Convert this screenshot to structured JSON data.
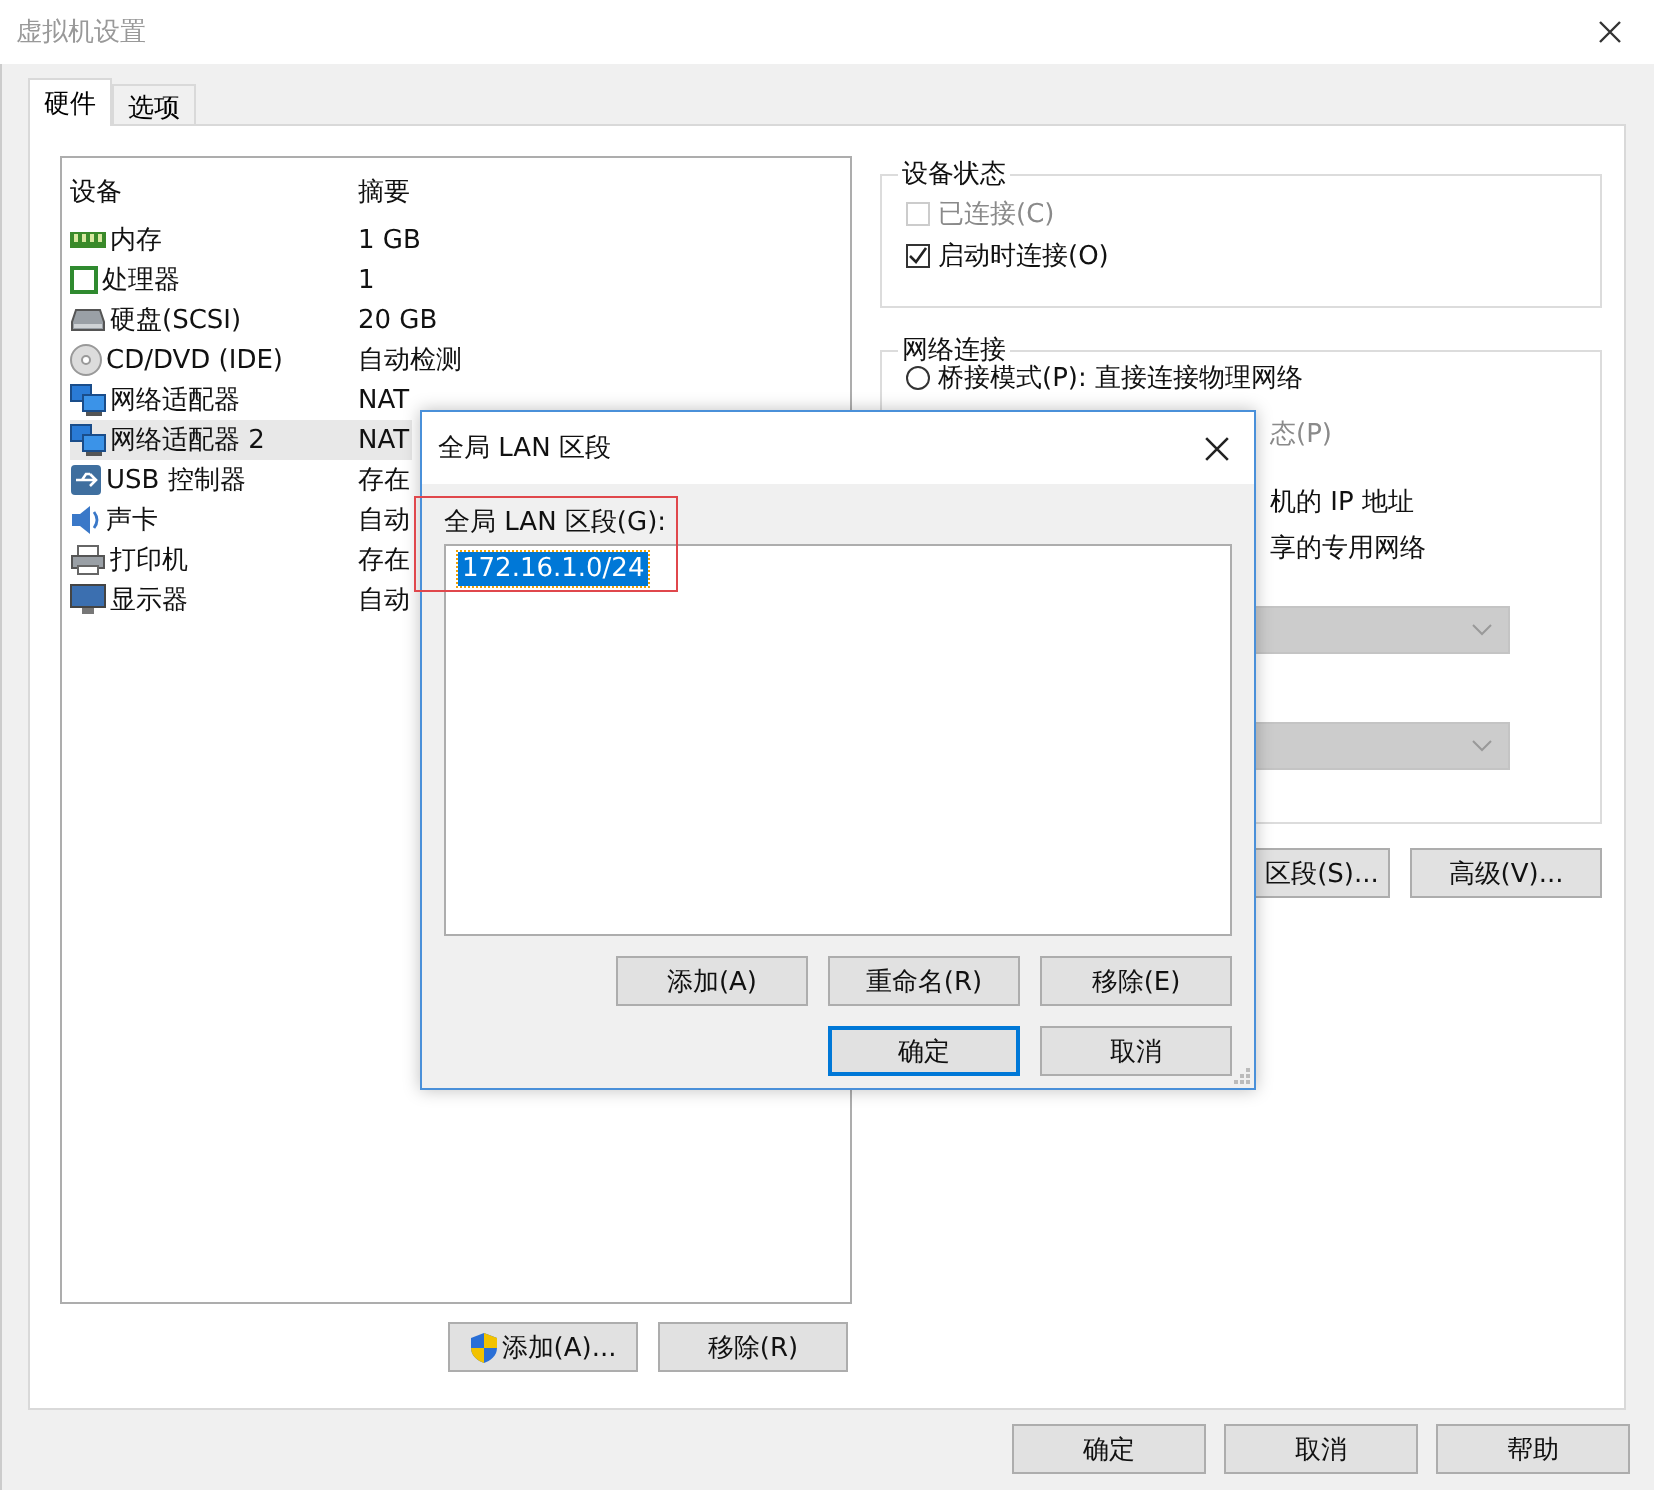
{
  "window": {
    "title": "虚拟机设置"
  },
  "tabs": [
    {
      "label": "硬件",
      "selected": true
    },
    {
      "label": "选项",
      "selected": false
    }
  ],
  "devices": {
    "columns": [
      "设备",
      "摘要"
    ],
    "rows": [
      {
        "kind": "memory",
        "name": "内存",
        "summary": "1 GB",
        "selected": false
      },
      {
        "kind": "cpu",
        "name": "处理器",
        "summary": "1",
        "selected": false
      },
      {
        "kind": "disk",
        "name": "硬盘(SCSI)",
        "summary": "20 GB",
        "selected": false
      },
      {
        "kind": "cdrom",
        "name": "CD/DVD (IDE)",
        "summary": "自动检测",
        "selected": false
      },
      {
        "kind": "network",
        "name": "网络适配器",
        "summary": "NAT",
        "selected": false
      },
      {
        "kind": "network",
        "name": "网络适配器 2",
        "summary": "NAT",
        "selected": true
      },
      {
        "kind": "usb",
        "name": "USB 控制器",
        "summary": "存在",
        "selected": false
      },
      {
        "kind": "sound",
        "name": "声卡",
        "summary": "自动",
        "selected": false
      },
      {
        "kind": "printer",
        "name": "打印机",
        "summary": "存在",
        "selected": false
      },
      {
        "kind": "display",
        "name": "显示器",
        "summary": "自动",
        "selected": false
      }
    ]
  },
  "device_buttons": [
    {
      "label": "添加(A)...",
      "shield": true
    },
    {
      "label": "移除(R)",
      "shield": false
    }
  ],
  "device_status": {
    "title": "设备状态",
    "options": [
      {
        "label": "已连接(C)",
        "checked": false,
        "disabled": true
      },
      {
        "label": "启动时连接(O)",
        "checked": true,
        "disabled": false
      }
    ]
  },
  "network": {
    "title": "网络连接",
    "radio": {
      "label": "桥接模式(P): 直接连接物理网络",
      "selected": false
    },
    "fragments": [
      "态(P)",
      "机的 IP 地址",
      "享的专用网络"
    ],
    "dropdowns": [
      {
        "disabled": true
      },
      {
        "disabled": true
      }
    ]
  },
  "network_buttons": [
    "区段(S)...",
    "高级(V)..."
  ],
  "footer_buttons": [
    "确定",
    "取消",
    "帮助"
  ],
  "dialog": {
    "title": "全局 LAN 区段",
    "list_label": "全局 LAN 区段(G):",
    "items": [
      {
        "label": "172.16.1.0/24",
        "selected": true
      }
    ],
    "buttons": [
      "添加(A)",
      "重命名(R)",
      "移除(E)"
    ],
    "actions": [
      {
        "label": "确定",
        "default": true
      },
      {
        "label": "取消",
        "default": false
      }
    ]
  },
  "annotation": {
    "kind": "highlight-box"
  }
}
